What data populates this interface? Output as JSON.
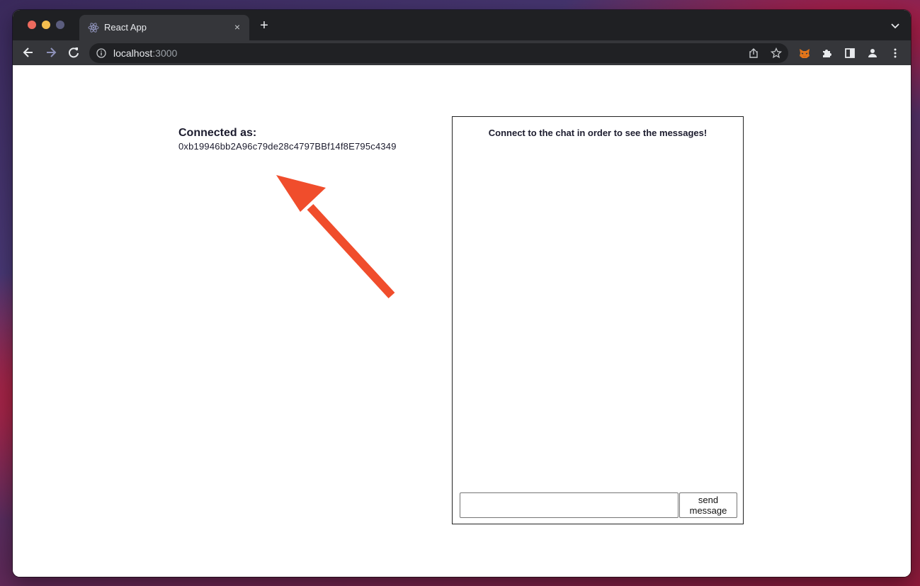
{
  "browser": {
    "tab_title": "React App",
    "tab_close": "×",
    "new_tab": "+",
    "url_host": "localhost",
    "url_port": ":3000"
  },
  "icons": {
    "tab_favicon": "react-logo-icon",
    "back": "arrow-left-icon",
    "forward": "arrow-right-icon",
    "reload": "reload-icon",
    "site_info": "info-icon",
    "share": "share-icon",
    "bookmark": "star-icon",
    "metamask": "fox-icon",
    "extensions": "puzzle-icon",
    "side_panel": "side-panel-icon",
    "profile": "person-icon",
    "menu": "kebab-menu-icon",
    "tab_search": "chevron-down-icon"
  },
  "app": {
    "connected_label": "Connected as:",
    "address": "0xb19946bb2A96c79de28c4797BBf14f8E795c4349",
    "chat_heading": "Connect to the chat in order to see the messages!",
    "message_input_value": "",
    "send_button_label": "send message"
  },
  "colors": {
    "arrow": "#f04d2c",
    "browser_frame": "#1f2023",
    "toolbar": "#35363a"
  }
}
